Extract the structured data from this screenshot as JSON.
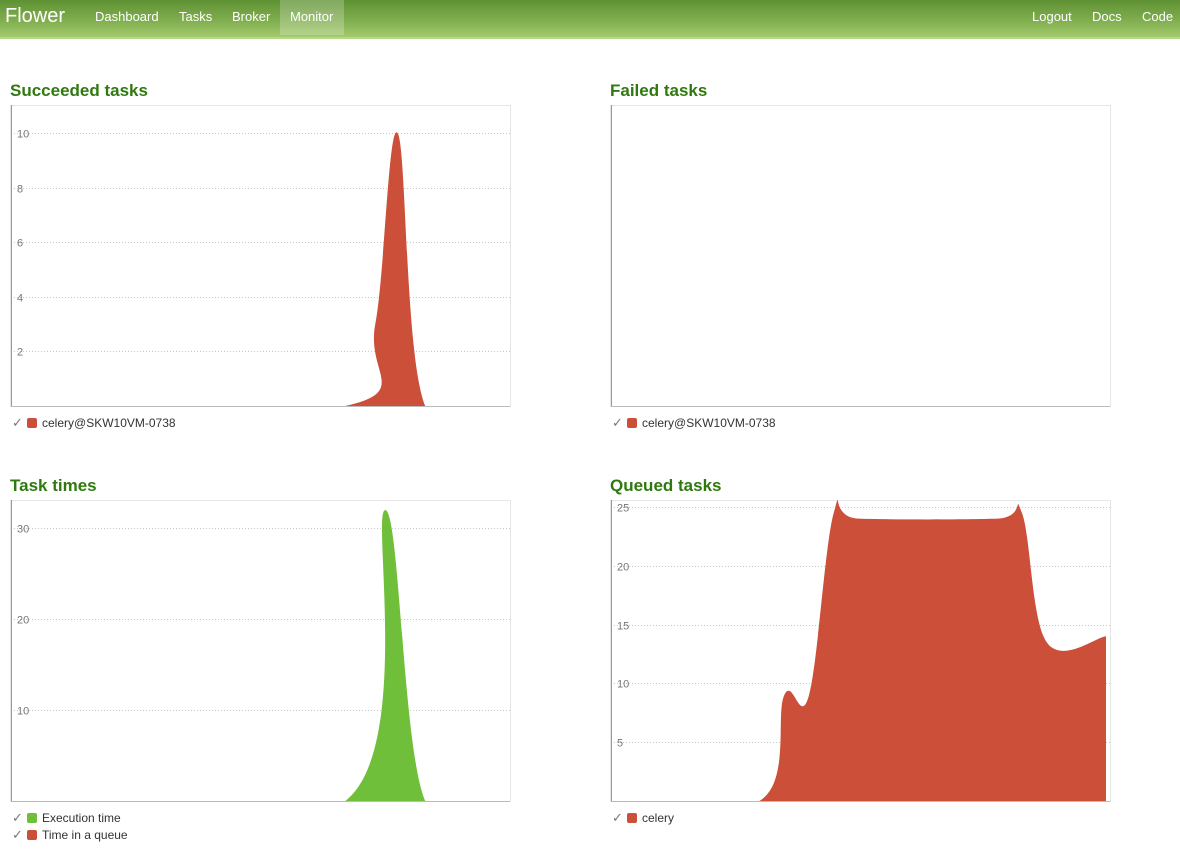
{
  "app": {
    "brand": "Flower",
    "nav_left": [
      "Dashboard",
      "Tasks",
      "Broker",
      "Monitor"
    ],
    "active_nav": "Monitor",
    "nav_right": [
      "Logout",
      "Docs",
      "Code"
    ]
  },
  "colors": {
    "red_series": "#cc4f3a",
    "green_series": "#70bf3a",
    "title_green": "#2f7a0e"
  },
  "chart_data": [
    {
      "title": "Succeeded tasks",
      "type": "area",
      "ylim": [
        0,
        11
      ],
      "yticks": [
        2,
        4,
        6,
        8,
        10
      ],
      "xlim": [
        0,
        100
      ],
      "series": [
        {
          "name": "celery@SKW10VM-0738",
          "color": "#cc4f3a",
          "points": [
            [
              0,
              0
            ],
            [
              67,
              0
            ],
            [
              73,
              3
            ],
            [
              77.5,
              10
            ],
            [
              83,
              0
            ],
            [
              100,
              0
            ]
          ]
        }
      ]
    },
    {
      "title": "Failed tasks",
      "type": "area",
      "ylim": [
        0,
        11
      ],
      "yticks": [],
      "xlim": [
        0,
        100
      ],
      "series": [
        {
          "name": "celery@SKW10VM-0738",
          "color": "#cc4f3a",
          "points": []
        }
      ]
    },
    {
      "title": "Task times",
      "type": "area",
      "ylim": [
        0,
        33
      ],
      "yticks": [
        10,
        20,
        30
      ],
      "xlim": [
        0,
        100
      ],
      "series": [
        {
          "name": "Execution time",
          "color": "#70bf3a",
          "points": [
            [
              0,
              0
            ],
            [
              67,
              0
            ],
            [
              75,
              32
            ],
            [
              83,
              0
            ],
            [
              100,
              0
            ]
          ]
        },
        {
          "name": "Time in a queue",
          "color": "#cc4f3a",
          "points": []
        }
      ]
    },
    {
      "title": "Queued tasks",
      "type": "area",
      "ylim": [
        0,
        25.5
      ],
      "yticks": [
        5,
        10,
        15,
        20,
        25
      ],
      "xlim": [
        0,
        100
      ],
      "series": [
        {
          "name": "celery",
          "color": "#cc4f3a",
          "points": [
            [
              0,
              0
            ],
            [
              30,
              0
            ],
            [
              35,
              9
            ],
            [
              40,
              9
            ],
            [
              45,
              24.5
            ],
            [
              50,
              24
            ],
            [
              78,
              24
            ],
            [
              83,
              24.5
            ],
            [
              88,
              13.5
            ],
            [
              100,
              14
            ]
          ]
        }
      ]
    }
  ]
}
